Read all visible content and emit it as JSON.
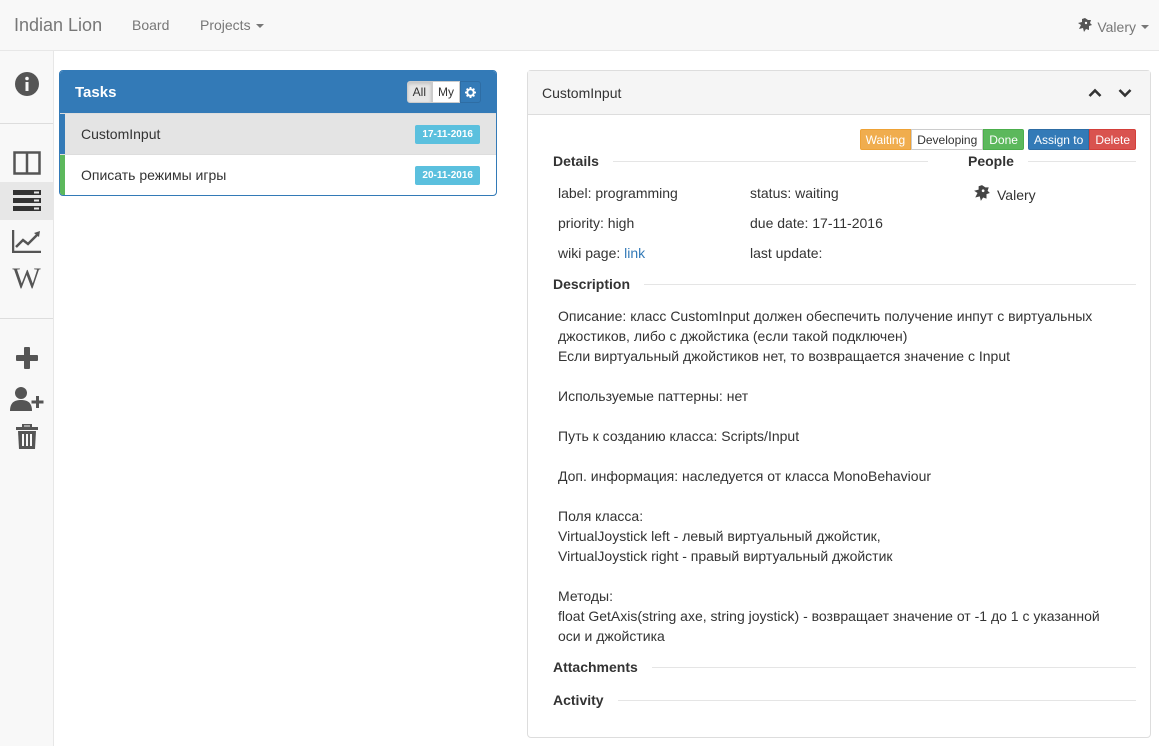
{
  "navbar": {
    "brand": "Indian Lion",
    "board_label": "Board",
    "projects_label": "Projects",
    "user_name": "Valery"
  },
  "sidebar": {
    "items": [
      {
        "icon": "info-icon"
      },
      {
        "icon": "columns-icon"
      },
      {
        "icon": "list-icon",
        "active": true
      },
      {
        "icon": "line-chart-icon"
      },
      {
        "icon": "wikipedia-icon"
      },
      {
        "icon": "plus-icon"
      },
      {
        "icon": "user-plus-icon"
      },
      {
        "icon": "trash-icon"
      }
    ]
  },
  "tasks": {
    "title": "Tasks",
    "filter_all": "All",
    "filter_my": "My",
    "rows": [
      {
        "name": "CustomInput",
        "date": "17-11-2016",
        "color": "#337ab7",
        "selected": true
      },
      {
        "name": "Описать режимы игры",
        "date": "20-11-2016",
        "color": "#5cb85c",
        "selected": false
      }
    ]
  },
  "detail": {
    "title": "CustomInput",
    "status_buttons": {
      "waiting": "Waiting",
      "developing": "Developing",
      "done": "Done",
      "assign": "Assign to",
      "delete": "Delete"
    },
    "details_heading": "Details",
    "people_heading": "People",
    "label": "label: programming",
    "status": "status: waiting",
    "priority": "priority: high",
    "due_date": "due date: 17-11-2016",
    "wiki_prefix": "wiki page: ",
    "wiki_link": "link",
    "last_update": "last update:",
    "person": "Valery",
    "description_heading": "Description",
    "description_lines": [
      "Описание: класс CustomInput должен обеспечить получение инпут с виртуальных",
      "джостиков, либо с джойстика (если такой подключен)",
      "Если виртуальный джойстиков нет, то возвращается значение с Input",
      "",
      "Используемые паттерны: нет",
      "",
      "Путь к созданию класса: Scripts/Input",
      "",
      "Доп. информация: наследуется от класса MonoBehaviour",
      "",
      "Поля класса:",
      "VirtualJoystick left - левый виртуальный джойстик,",
      "VirtualJoystick right - правый виртуальный джойстик",
      "",
      "Методы:",
      "float GetAxis(string axe, string joystick) - возвращает значение от -1 до 1 с указанной",
      "оси и джойстика"
    ],
    "attachments_heading": "Attachments",
    "activity_heading": "Activity"
  }
}
